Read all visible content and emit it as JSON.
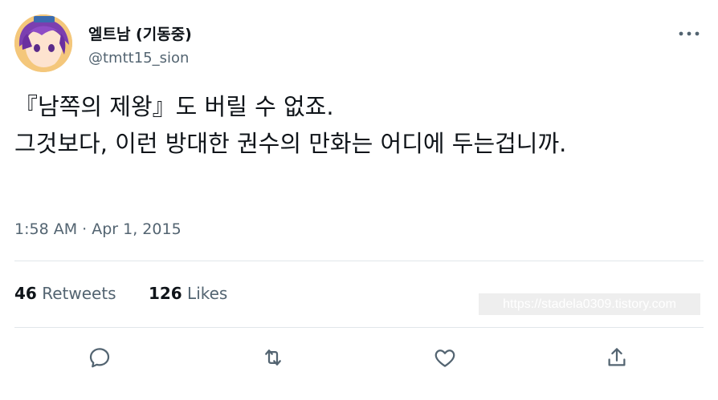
{
  "author": {
    "display_name": "엘트남 (기동중)",
    "handle": "@tmtt15_sion",
    "avatar_icon": "anime-avatar-icon"
  },
  "tweet": {
    "text": "『남쪽의 제왕』도 버릴 수 없죠.\n그것보다, 이런 방대한 권수의 만화는 어디에 두는겁니까.",
    "time": "1:58 AM",
    "separator": " · ",
    "date": "Apr 1, 2015"
  },
  "stats": {
    "retweets_count": "46",
    "retweets_label": "Retweets",
    "likes_count": "126",
    "likes_label": "Likes"
  },
  "watermark": "https://stadela0309.tistory.com",
  "actions": [
    "reply-icon",
    "retweet-icon",
    "like-icon",
    "share-icon"
  ],
  "colors": {
    "text": "#0f1419",
    "secondary": "#536471",
    "divider": "#e1e6ea"
  }
}
